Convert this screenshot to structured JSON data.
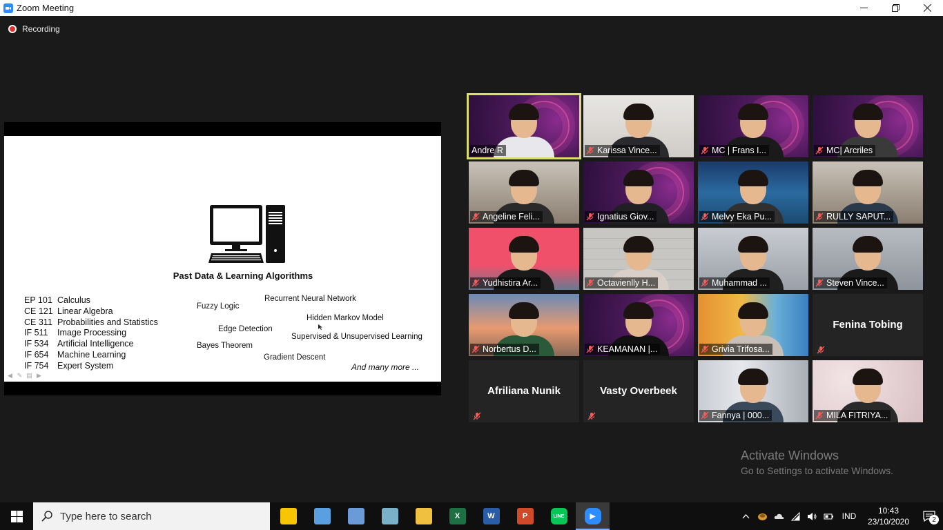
{
  "window": {
    "title": "Zoom Meeting"
  },
  "recording": {
    "label": "Recording"
  },
  "slide": {
    "heading": "Past Data & Learning Algorithms",
    "courses": [
      {
        "code": "EP 101",
        "name": "Calculus"
      },
      {
        "code": "CE 121",
        "name": "Linear Algebra"
      },
      {
        "code": "CE 311",
        "name": "Probabilities and Statistics"
      },
      {
        "code": "IF 511",
        "name": "Image Processing"
      },
      {
        "code": "IF 534",
        "name": "Artificial Intelligence"
      },
      {
        "code": "IF 654",
        "name": "Machine Learning"
      },
      {
        "code": "IF 754",
        "name": "Expert System"
      }
    ],
    "algorithms": [
      "Fuzzy Logic",
      "Recurrent Neural Network",
      "Hidden Markov Model",
      "Edge Detection",
      "Supervised & Unsupervised Learning",
      "Bayes Theorem",
      "Gradient Descent"
    ],
    "more": "And many more ..."
  },
  "participants": [
    {
      "name": "Andre R",
      "muted": false,
      "active": true,
      "video": "bids"
    },
    {
      "name": "Karissa Vince...",
      "muted": true,
      "video": "white"
    },
    {
      "name": "MC | Frans I...",
      "muted": true,
      "video": "bids"
    },
    {
      "name": "MC| Arcriles",
      "muted": true,
      "video": "bids"
    },
    {
      "name": "Angeline Feli...",
      "muted": true,
      "video": "room"
    },
    {
      "name": "Ignatius Giov...",
      "muted": true,
      "video": "bids"
    },
    {
      "name": "Melvy Eka Pu...",
      "muted": true,
      "video": "ocean"
    },
    {
      "name": "RULLY SAPUT...",
      "muted": true,
      "video": "room"
    },
    {
      "name": "Yudhistira Ar...",
      "muted": true,
      "video": "pink"
    },
    {
      "name": "Octavienlly H...",
      "muted": true,
      "video": "brick"
    },
    {
      "name": "Muhammad ...",
      "muted": true,
      "video": "dim"
    },
    {
      "name": "Steven Vince...",
      "muted": true,
      "video": "gray"
    },
    {
      "name": "Norbertus D...",
      "muted": true,
      "video": "bridge"
    },
    {
      "name": "KEAMANAN |...",
      "muted": true,
      "video": "bids"
    },
    {
      "name": "Grivia Trifosa...",
      "muted": true,
      "video": "sponge"
    },
    {
      "name": "Fenina Tobing",
      "muted": true,
      "video": "none"
    },
    {
      "name": "Afriliana Nunik",
      "muted": true,
      "video": "none"
    },
    {
      "name": "Vasty Overbeek",
      "muted": true,
      "video": "none"
    },
    {
      "name": "Fannya | 000...",
      "muted": true,
      "video": "curtain"
    },
    {
      "name": "MILA FITRIYA...",
      "muted": true,
      "video": "floral"
    }
  ],
  "watermark": {
    "line1": "Activate Windows",
    "line2": "Go to Settings to activate Windows."
  },
  "taskbar": {
    "search_placeholder": "Type here to search",
    "language": "IND",
    "time": "10:43",
    "date": "23/10/2020",
    "notification_count": "2",
    "apps": [
      {
        "name": "sticky-notes",
        "color": "#f7c600"
      },
      {
        "name": "paint",
        "color": "#5aa0e0"
      },
      {
        "name": "paint-3d",
        "color": "#6a9ad8"
      },
      {
        "name": "notes",
        "color": "#7ab0c8"
      },
      {
        "name": "file-explorer",
        "color": "#f0c040"
      },
      {
        "name": "excel",
        "color": "#1d7044"
      },
      {
        "name": "word",
        "color": "#2b5ca8"
      },
      {
        "name": "powerpoint",
        "color": "#d04a2a"
      },
      {
        "name": "line",
        "color": "#06c755"
      },
      {
        "name": "zoom",
        "color": "#2d8cff"
      }
    ]
  }
}
